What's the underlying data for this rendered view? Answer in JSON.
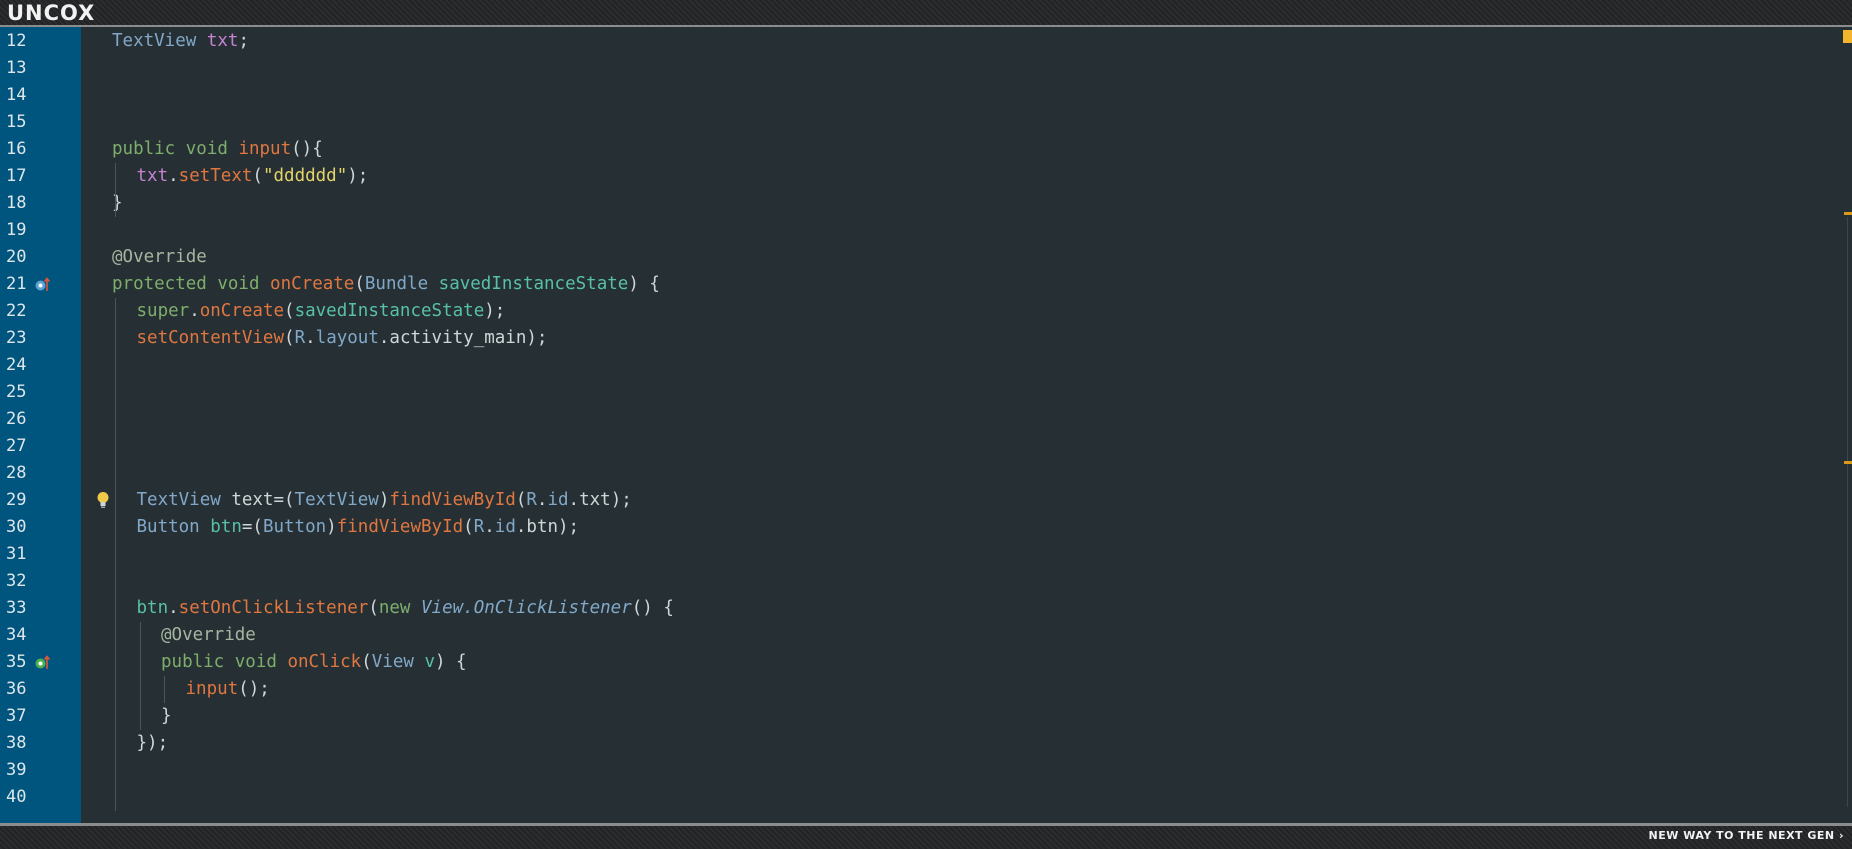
{
  "header": {
    "logo": "UNCOX"
  },
  "footer": {
    "tagline": "NEW WAY TO THE NEXT GEN ›"
  },
  "colors": {
    "gutter": "#00557f",
    "background": "#263034",
    "keyword": "#7eae6c",
    "method": "#e07640",
    "type": "#82a8c8",
    "field": "#c582d1",
    "string": "#e3d46a",
    "annotation": "#a6b5a0",
    "plain": "#cfd6d8",
    "local": "#58c0a8"
  },
  "editor": {
    "lines": [
      {
        "num": "12",
        "tokens": [
          {
            "t": "TextView ",
            "c": "type"
          },
          {
            "t": "txt",
            "c": "field"
          },
          {
            "t": ";",
            "c": "plain"
          }
        ]
      },
      {
        "num": "13",
        "tokens": []
      },
      {
        "num": "14",
        "tokens": []
      },
      {
        "num": "15",
        "tokens": []
      },
      {
        "num": "16",
        "tokens": [
          {
            "t": "public void ",
            "c": "keyword"
          },
          {
            "t": "input",
            "c": "method"
          },
          {
            "t": "(){",
            "c": "plain"
          }
        ]
      },
      {
        "num": "17",
        "tokens": [
          {
            "t": "txt",
            "c": "field"
          },
          {
            "t": ".",
            "c": "plain"
          },
          {
            "t": "setText",
            "c": "method"
          },
          {
            "t": "(",
            "c": "plain"
          },
          {
            "t": "\"dddddd\"",
            "c": "string"
          },
          {
            "t": ");",
            "c": "plain"
          }
        ]
      },
      {
        "num": "18",
        "tokens": [
          {
            "t": "}",
            "c": "plain"
          }
        ]
      },
      {
        "num": "19",
        "tokens": []
      },
      {
        "num": "20",
        "tokens": [
          {
            "t": "@Override",
            "c": "annotation"
          }
        ]
      },
      {
        "num": "21",
        "icon": "override-circle-icon",
        "tokens": [
          {
            "t": "protected void ",
            "c": "keyword"
          },
          {
            "t": "onCreate",
            "c": "method"
          },
          {
            "t": "(",
            "c": "plain"
          },
          {
            "t": "Bundle ",
            "c": "type"
          },
          {
            "t": "savedInstanceState",
            "c": "local"
          },
          {
            "t": ") {",
            "c": "plain"
          }
        ]
      },
      {
        "num": "22",
        "tokens": [
          {
            "t": "super",
            "c": "keyword"
          },
          {
            "t": ".",
            "c": "plain"
          },
          {
            "t": "onCreate",
            "c": "method"
          },
          {
            "t": "(",
            "c": "plain"
          },
          {
            "t": "savedInstanceState",
            "c": "local"
          },
          {
            "t": ");",
            "c": "plain"
          }
        ]
      },
      {
        "num": "23",
        "tokens": [
          {
            "t": "setContentView",
            "c": "method"
          },
          {
            "t": "(",
            "c": "plain"
          },
          {
            "t": "R",
            "c": "type"
          },
          {
            "t": ".",
            "c": "plain"
          },
          {
            "t": "layout",
            "c": "type"
          },
          {
            "t": ".activity_main);",
            "c": "plain"
          }
        ]
      },
      {
        "num": "24",
        "tokens": []
      },
      {
        "num": "25",
        "tokens": []
      },
      {
        "num": "26",
        "tokens": []
      },
      {
        "num": "27",
        "tokens": []
      },
      {
        "num": "28",
        "tokens": []
      },
      {
        "num": "29",
        "bulb": true,
        "tokens": [
          {
            "t": "TextView ",
            "c": "type"
          },
          {
            "t": "text=(",
            "c": "plain"
          },
          {
            "t": "TextView",
            "c": "type"
          },
          {
            "t": ")",
            "c": "plain"
          },
          {
            "t": "findViewById",
            "c": "method"
          },
          {
            "t": "(",
            "c": "plain"
          },
          {
            "t": "R",
            "c": "type"
          },
          {
            "t": ".",
            "c": "plain"
          },
          {
            "t": "id",
            "c": "type"
          },
          {
            "t": ".txt);",
            "c": "plain"
          }
        ]
      },
      {
        "num": "30",
        "tokens": [
          {
            "t": "Button ",
            "c": "type"
          },
          {
            "t": "btn",
            "c": "local"
          },
          {
            "t": "=(",
            "c": "plain"
          },
          {
            "t": "Button",
            "c": "type"
          },
          {
            "t": ")",
            "c": "plain"
          },
          {
            "t": "findViewById",
            "c": "method"
          },
          {
            "t": "(",
            "c": "plain"
          },
          {
            "t": "R",
            "c": "type"
          },
          {
            "t": ".",
            "c": "plain"
          },
          {
            "t": "id",
            "c": "type"
          },
          {
            "t": ".btn);",
            "c": "plain"
          }
        ]
      },
      {
        "num": "31",
        "tokens": []
      },
      {
        "num": "32",
        "tokens": []
      },
      {
        "num": "33",
        "tokens": [
          {
            "t": "btn",
            "c": "local"
          },
          {
            "t": ".",
            "c": "plain"
          },
          {
            "t": "setOnClickListener",
            "c": "method"
          },
          {
            "t": "(",
            "c": "plain"
          },
          {
            "t": "new ",
            "c": "keyword"
          },
          {
            "t": "View.OnClickListener",
            "c": "italic"
          },
          {
            "t": "() {",
            "c": "plain"
          }
        ]
      },
      {
        "num": "34",
        "tokens": [
          {
            "t": "@Override",
            "c": "annotation"
          }
        ]
      },
      {
        "num": "35",
        "icon": "implement-circle-icon",
        "tokens": [
          {
            "t": "public void ",
            "c": "keyword"
          },
          {
            "t": "onClick",
            "c": "method"
          },
          {
            "t": "(",
            "c": "plain"
          },
          {
            "t": "View ",
            "c": "type"
          },
          {
            "t": "v",
            "c": "local"
          },
          {
            "t": ") {",
            "c": "plain"
          }
        ]
      },
      {
        "num": "36",
        "tokens": [
          {
            "t": "input",
            "c": "method"
          },
          {
            "t": "();",
            "c": "plain"
          }
        ]
      },
      {
        "num": "37",
        "tokens": [
          {
            "t": "}",
            "c": "plain"
          }
        ]
      },
      {
        "num": "38",
        "tokens": [
          {
            "t": "});",
            "c": "plain"
          }
        ]
      },
      {
        "num": "39",
        "tokens": []
      },
      {
        "num": "40",
        "tokens": []
      }
    ]
  }
}
